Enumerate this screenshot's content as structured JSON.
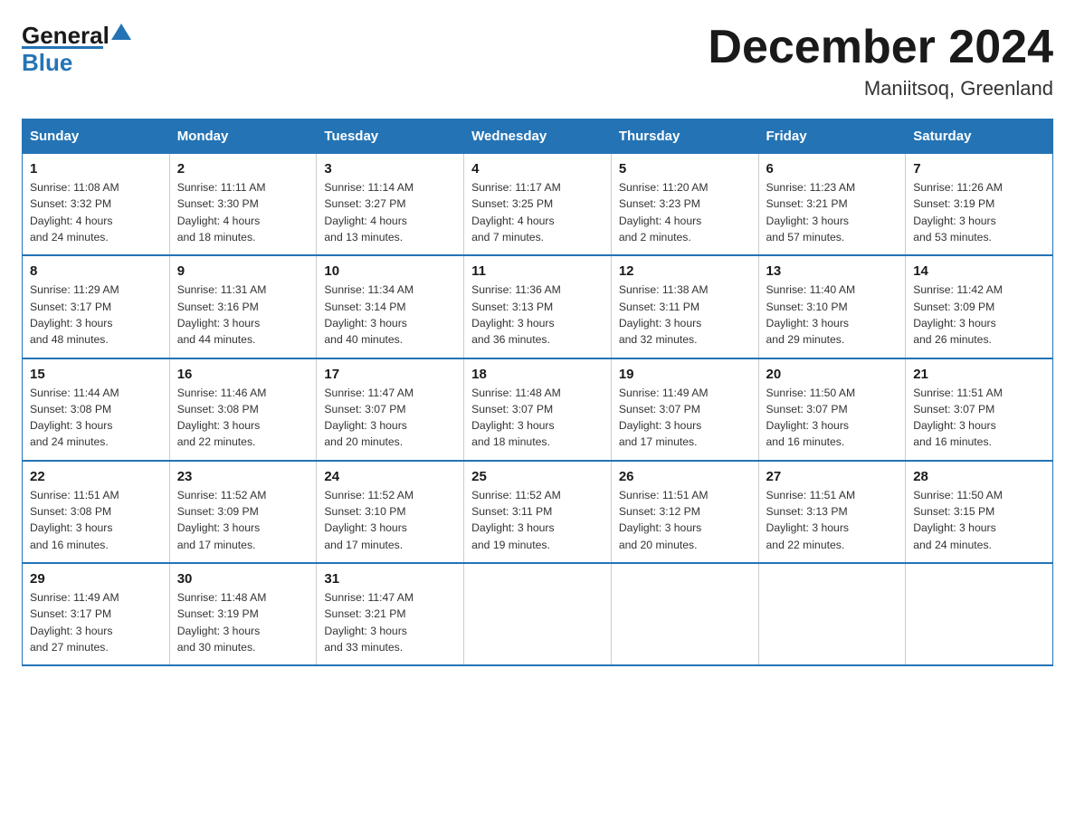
{
  "header": {
    "logo_general": "General",
    "logo_blue": "Blue",
    "month_title": "December 2024",
    "location": "Maniitsoq, Greenland"
  },
  "days_of_week": [
    "Sunday",
    "Monday",
    "Tuesday",
    "Wednesday",
    "Thursday",
    "Friday",
    "Saturday"
  ],
  "weeks": [
    [
      {
        "day": "1",
        "sunrise": "11:08 AM",
        "sunset": "3:32 PM",
        "daylight": "4 hours and 24 minutes."
      },
      {
        "day": "2",
        "sunrise": "11:11 AM",
        "sunset": "3:30 PM",
        "daylight": "4 hours and 18 minutes."
      },
      {
        "day": "3",
        "sunrise": "11:14 AM",
        "sunset": "3:27 PM",
        "daylight": "4 hours and 13 minutes."
      },
      {
        "day": "4",
        "sunrise": "11:17 AM",
        "sunset": "3:25 PM",
        "daylight": "4 hours and 7 minutes."
      },
      {
        "day": "5",
        "sunrise": "11:20 AM",
        "sunset": "3:23 PM",
        "daylight": "4 hours and 2 minutes."
      },
      {
        "day": "6",
        "sunrise": "11:23 AM",
        "sunset": "3:21 PM",
        "daylight": "3 hours and 57 minutes."
      },
      {
        "day": "7",
        "sunrise": "11:26 AM",
        "sunset": "3:19 PM",
        "daylight": "3 hours and 53 minutes."
      }
    ],
    [
      {
        "day": "8",
        "sunrise": "11:29 AM",
        "sunset": "3:17 PM",
        "daylight": "3 hours and 48 minutes."
      },
      {
        "day": "9",
        "sunrise": "11:31 AM",
        "sunset": "3:16 PM",
        "daylight": "3 hours and 44 minutes."
      },
      {
        "day": "10",
        "sunrise": "11:34 AM",
        "sunset": "3:14 PM",
        "daylight": "3 hours and 40 minutes."
      },
      {
        "day": "11",
        "sunrise": "11:36 AM",
        "sunset": "3:13 PM",
        "daylight": "3 hours and 36 minutes."
      },
      {
        "day": "12",
        "sunrise": "11:38 AM",
        "sunset": "3:11 PM",
        "daylight": "3 hours and 32 minutes."
      },
      {
        "day": "13",
        "sunrise": "11:40 AM",
        "sunset": "3:10 PM",
        "daylight": "3 hours and 29 minutes."
      },
      {
        "day": "14",
        "sunrise": "11:42 AM",
        "sunset": "3:09 PM",
        "daylight": "3 hours and 26 minutes."
      }
    ],
    [
      {
        "day": "15",
        "sunrise": "11:44 AM",
        "sunset": "3:08 PM",
        "daylight": "3 hours and 24 minutes."
      },
      {
        "day": "16",
        "sunrise": "11:46 AM",
        "sunset": "3:08 PM",
        "daylight": "3 hours and 22 minutes."
      },
      {
        "day": "17",
        "sunrise": "11:47 AM",
        "sunset": "3:07 PM",
        "daylight": "3 hours and 20 minutes."
      },
      {
        "day": "18",
        "sunrise": "11:48 AM",
        "sunset": "3:07 PM",
        "daylight": "3 hours and 18 minutes."
      },
      {
        "day": "19",
        "sunrise": "11:49 AM",
        "sunset": "3:07 PM",
        "daylight": "3 hours and 17 minutes."
      },
      {
        "day": "20",
        "sunrise": "11:50 AM",
        "sunset": "3:07 PM",
        "daylight": "3 hours and 16 minutes."
      },
      {
        "day": "21",
        "sunrise": "11:51 AM",
        "sunset": "3:07 PM",
        "daylight": "3 hours and 16 minutes."
      }
    ],
    [
      {
        "day": "22",
        "sunrise": "11:51 AM",
        "sunset": "3:08 PM",
        "daylight": "3 hours and 16 minutes."
      },
      {
        "day": "23",
        "sunrise": "11:52 AM",
        "sunset": "3:09 PM",
        "daylight": "3 hours and 17 minutes."
      },
      {
        "day": "24",
        "sunrise": "11:52 AM",
        "sunset": "3:10 PM",
        "daylight": "3 hours and 17 minutes."
      },
      {
        "day": "25",
        "sunrise": "11:52 AM",
        "sunset": "3:11 PM",
        "daylight": "3 hours and 19 minutes."
      },
      {
        "day": "26",
        "sunrise": "11:51 AM",
        "sunset": "3:12 PM",
        "daylight": "3 hours and 20 minutes."
      },
      {
        "day": "27",
        "sunrise": "11:51 AM",
        "sunset": "3:13 PM",
        "daylight": "3 hours and 22 minutes."
      },
      {
        "day": "28",
        "sunrise": "11:50 AM",
        "sunset": "3:15 PM",
        "daylight": "3 hours and 24 minutes."
      }
    ],
    [
      {
        "day": "29",
        "sunrise": "11:49 AM",
        "sunset": "3:17 PM",
        "daylight": "3 hours and 27 minutes."
      },
      {
        "day": "30",
        "sunrise": "11:48 AM",
        "sunset": "3:19 PM",
        "daylight": "3 hours and 30 minutes."
      },
      {
        "day": "31",
        "sunrise": "11:47 AM",
        "sunset": "3:21 PM",
        "daylight": "3 hours and 33 minutes."
      },
      null,
      null,
      null,
      null
    ]
  ],
  "labels": {
    "sunrise": "Sunrise:",
    "sunset": "Sunset:",
    "daylight": "Daylight:"
  }
}
